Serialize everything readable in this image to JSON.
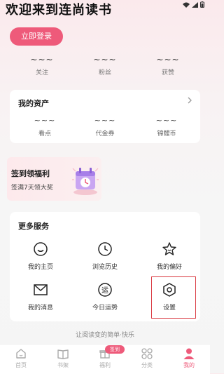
{
  "header": {
    "welcome": "欢迎来到连尚读书",
    "login_button": "立即登录"
  },
  "stats": [
    {
      "value": "~~~",
      "label": "关注"
    },
    {
      "value": "~~~",
      "label": "粉丝"
    },
    {
      "value": "~~~",
      "label": "获赞"
    }
  ],
  "assets": {
    "title": "我的资产",
    "items": [
      {
        "value": "~~~",
        "label": "看点"
      },
      {
        "value": "~~~",
        "label": "代金券"
      },
      {
        "value": "~~~",
        "label": "锦鲤币"
      }
    ]
  },
  "signin": {
    "title": "签到领福利",
    "subtitle": "签满7天领大奖"
  },
  "services": {
    "title": "更多服务",
    "items": [
      {
        "label": "我的主页",
        "icon": "smile-icon"
      },
      {
        "label": "浏览历史",
        "icon": "clock-icon"
      },
      {
        "label": "我的偏好",
        "icon": "star-icon"
      },
      {
        "label": "我的消息",
        "icon": "envelope-icon"
      },
      {
        "label": "今日运势",
        "icon": "fortune-icon"
      },
      {
        "label": "设置",
        "icon": "settings-icon"
      }
    ]
  },
  "slogan": "让阅读变的简单·快乐",
  "tabbar": {
    "badge": "签到",
    "items": [
      {
        "label": "首页",
        "icon": "home-icon",
        "active": false
      },
      {
        "label": "书架",
        "icon": "book-icon",
        "active": false
      },
      {
        "label": "福利",
        "icon": "gift-icon",
        "active": false
      },
      {
        "label": "分类",
        "icon": "grid-icon",
        "active": false
      },
      {
        "label": "我的",
        "icon": "person-icon",
        "active": true
      }
    ]
  },
  "colors": {
    "accent": "#ee5a7a",
    "highlight": "#d9363e"
  }
}
